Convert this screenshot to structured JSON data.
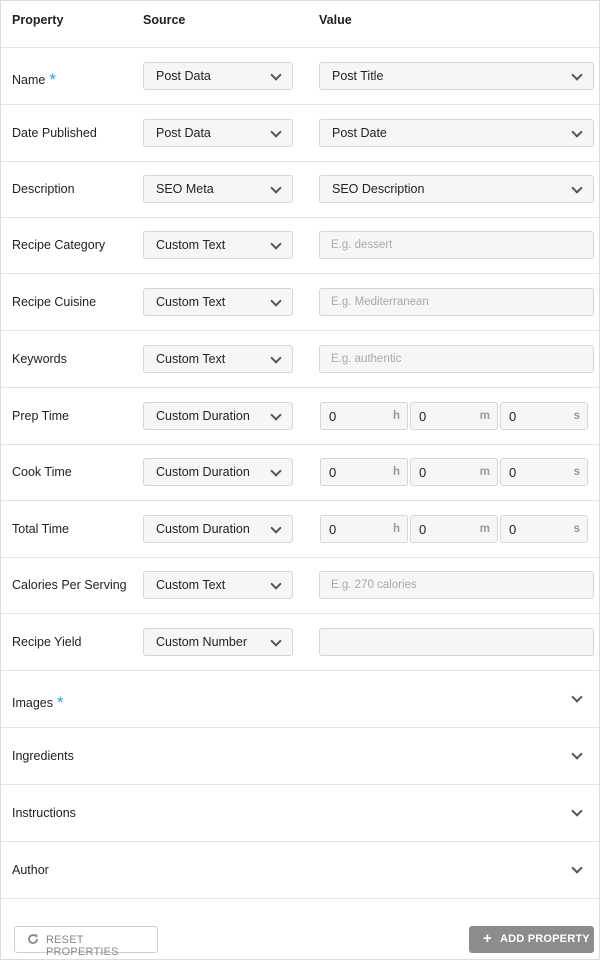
{
  "header": {
    "property": "Property",
    "source": "Source",
    "value": "Value"
  },
  "rows": [
    {
      "label": "Name",
      "required": true,
      "source": "Post Data",
      "value_type": "select",
      "value": "Post Title"
    },
    {
      "label": "Date Published",
      "required": false,
      "source": "Post Data",
      "value_type": "select",
      "value": "Post Date"
    },
    {
      "label": "Description",
      "required": false,
      "source": "SEO Meta",
      "value_type": "select",
      "value": "SEO Description"
    },
    {
      "label": "Recipe Category",
      "required": false,
      "source": "Custom Text",
      "value_type": "text",
      "placeholder": "E.g. dessert"
    },
    {
      "label": "Recipe Cuisine",
      "required": false,
      "source": "Custom Text",
      "value_type": "text",
      "placeholder": "E.g. Mediterranean"
    },
    {
      "label": "Keywords",
      "required": false,
      "source": "Custom Text",
      "value_type": "text",
      "placeholder": "E.g. authentic"
    },
    {
      "label": "Prep Time",
      "required": false,
      "source": "Custom Duration",
      "value_type": "duration",
      "h": "0",
      "m": "0",
      "s": "0"
    },
    {
      "label": "Cook Time",
      "required": false,
      "source": "Custom Duration",
      "value_type": "duration",
      "h": "0",
      "m": "0",
      "s": "0"
    },
    {
      "label": "Total Time",
      "required": false,
      "source": "Custom Duration",
      "value_type": "duration",
      "h": "0",
      "m": "0",
      "s": "0"
    },
    {
      "label": "Calories Per Serving",
      "required": false,
      "source": "Custom Text",
      "value_type": "text",
      "placeholder": "E.g. 270 calories"
    },
    {
      "label": "Recipe Yield",
      "required": false,
      "source": "Custom Number",
      "value_type": "text",
      "placeholder": ""
    }
  ],
  "duration_units": {
    "h": "h",
    "m": "m",
    "s": "s"
  },
  "accordions": [
    {
      "label": "Images",
      "required": true
    },
    {
      "label": "Ingredients",
      "required": false
    },
    {
      "label": "Instructions",
      "required": false
    },
    {
      "label": "Author",
      "required": false
    }
  ],
  "required_marker": "*",
  "footer": {
    "reset_label": "RESET PROPERTIES",
    "add_label": "ADD PROPERTY",
    "add_icon": "+"
  },
  "icons": {
    "reset": "refresh-icon",
    "add": "plus-icon",
    "dropdown": "chevron-down-icon"
  },
  "colors": {
    "required": "#2ba6de",
    "add_button": "#8c8c8c",
    "border": "#e3e3e3"
  }
}
